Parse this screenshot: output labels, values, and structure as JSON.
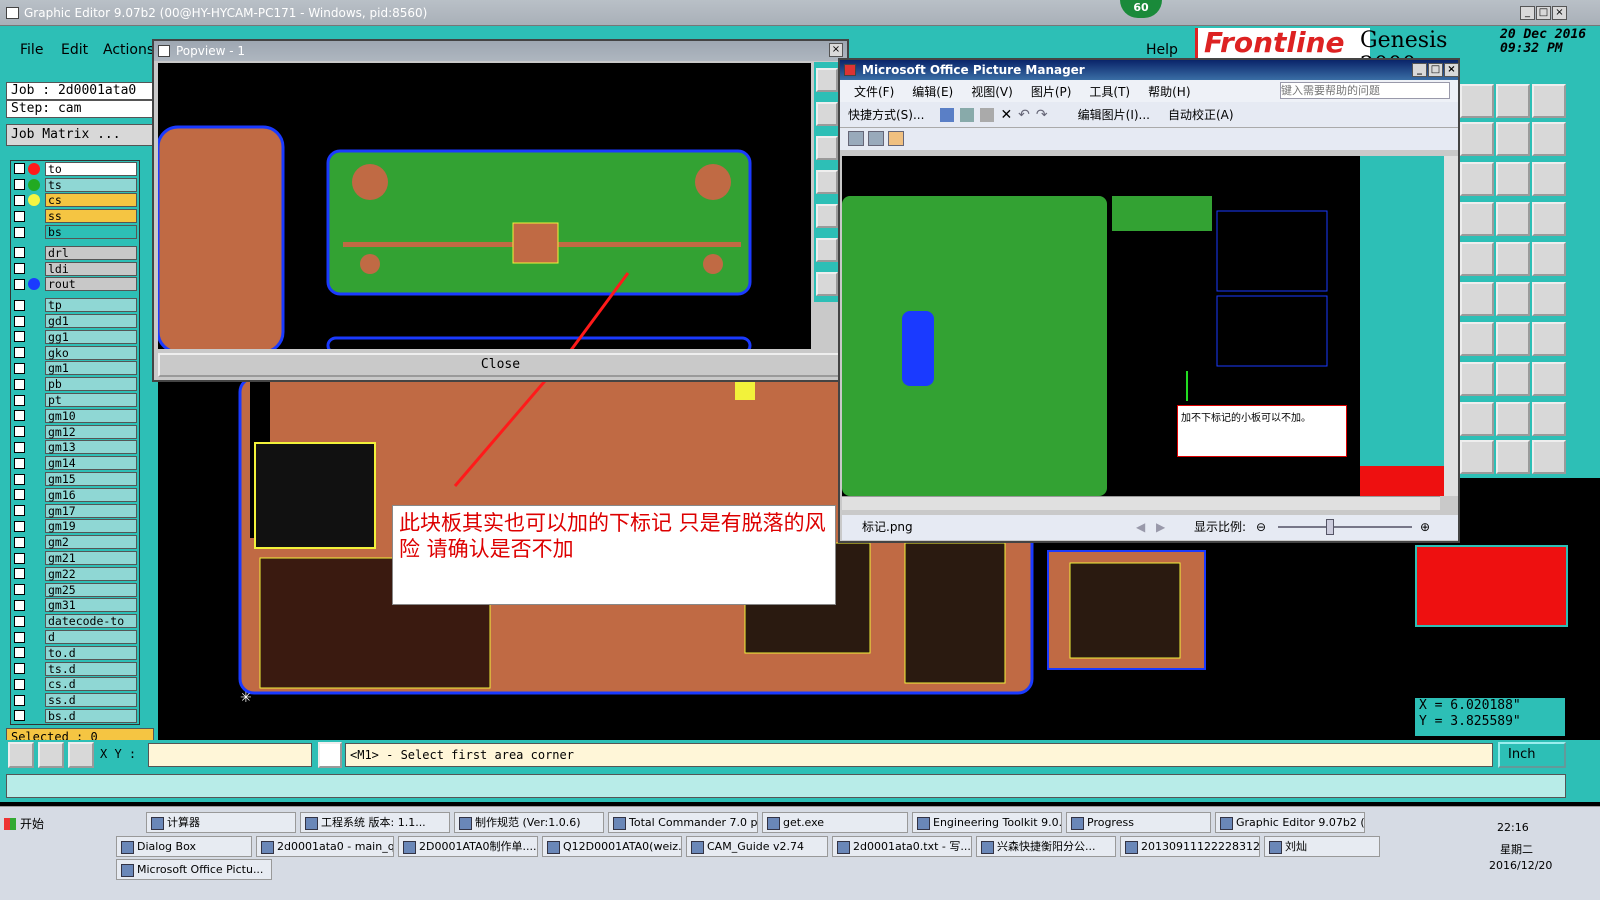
{
  "main_window": {
    "title": "Graphic Editor 9.07b2 (00@HY-HYCAM-PC171 - Windows, pid:8560)",
    "badge": "60",
    "menu": [
      "File",
      "Edit",
      "Actions"
    ],
    "help": "Help",
    "brand": "Frontline",
    "product": "Genesis 2000",
    "date": "20 Dec 2016",
    "time": "09:32 PM"
  },
  "left_panel": {
    "job": "Job : 2d0001ata0",
    "step": "Step: cam",
    "job_matrix": "Job Matrix ...",
    "selected": "Selected : 0"
  },
  "layers": [
    {
      "name": "to",
      "dot": "#ff1a1a",
      "bg": "#ffffff"
    },
    {
      "name": "ts",
      "dot": "#22aa22",
      "bg": "#8fd7d4"
    },
    {
      "name": "cs",
      "dot": "#f5f542",
      "bg": "#f5c542"
    },
    {
      "name": "ss",
      "dot": "",
      "bg": "#f5c542"
    },
    {
      "name": "bs",
      "dot": "",
      "bg": "#2dbfb6"
    },
    {
      "sep": true
    },
    {
      "name": "drl",
      "dot": "",
      "bg": "#c8c8c8"
    },
    {
      "name": "ldi",
      "dot": "",
      "bg": "#c8c8c8"
    },
    {
      "name": "rout",
      "dot": "#1a3aff",
      "bg": "#c8c8c8"
    },
    {
      "sep": true
    },
    {
      "name": "tp"
    },
    {
      "name": "gd1"
    },
    {
      "name": "gg1"
    },
    {
      "name": "gko"
    },
    {
      "name": "gm1"
    },
    {
      "name": "pb"
    },
    {
      "name": "pt"
    },
    {
      "name": "gm10"
    },
    {
      "name": "gm12"
    },
    {
      "name": "gm13"
    },
    {
      "name": "gm14"
    },
    {
      "name": "gm15"
    },
    {
      "name": "gm16"
    },
    {
      "name": "gm17"
    },
    {
      "name": "gm19"
    },
    {
      "name": "gm2"
    },
    {
      "name": "gm21"
    },
    {
      "name": "gm22"
    },
    {
      "name": "gm25"
    },
    {
      "name": "gm31"
    },
    {
      "name": "datecode-to"
    },
    {
      "name": "d"
    },
    {
      "name": "to.d"
    },
    {
      "name": "ts.d"
    },
    {
      "name": "cs.d"
    },
    {
      "name": "ss.d"
    },
    {
      "name": "bs.d"
    }
  ],
  "popview": {
    "title": "Popview - 1",
    "close_label": "Close"
  },
  "picture_manager": {
    "title": "Microsoft Office Picture Manager",
    "menu": [
      "文件(F)",
      "编辑(E)",
      "视图(V)",
      "图片(P)",
      "工具(T)",
      "帮助(H)"
    ],
    "help_placeholder": "键入需要帮助的问题",
    "shortcut": "快捷方式(S)...",
    "edit_picture": "编辑图片(I)...",
    "auto_correct": "自动校正(A)",
    "filename": "标记.png",
    "zoom_label": "显示比例:",
    "note": "加不下标记的小板可以不加。"
  },
  "callout": {
    "text": "此块板其实也可以加的下标记 只是有脱落的风险  请确认是否不加"
  },
  "coords": {
    "x": "X = 6.020188\"",
    "y": "Y = 3.825589\""
  },
  "status": {
    "xy_label": "X Y :",
    "xy_value": "",
    "prompt": "<M1> - Select first area corner",
    "units": "Inch"
  },
  "taskbar": {
    "start": "开始",
    "row1": [
      "计算器",
      "工程系统  版本: 1.1...",
      "制作规范 (Ver:1.0.6)",
      "Total Commander 7.0 p...",
      "get.exe",
      "Engineering Toolkit 9.0...",
      "Progress",
      "Graphic Editor 9.07b2 (..."
    ],
    "row2": [
      "Dialog Box",
      "2d0001ata0 - main_qa",
      "2D0001ATA0制作单....",
      "Q12D0001ATA0(weiz...",
      "CAM_Guide v2.74",
      "2d0001ata0.txt - 写...",
      "兴森快捷衡阳分公...",
      "20130911122228312...",
      "刘灿"
    ],
    "row3": [
      "Microsoft Office Pictu..."
    ],
    "clock_time": "22:16",
    "clock_day": "星期二",
    "clock_date": "2016/12/20"
  },
  "colors": {
    "teal": "#2dbfb6",
    "copper": "#c06a44",
    "green": "#33a233",
    "yellow": "#f2f23a"
  }
}
